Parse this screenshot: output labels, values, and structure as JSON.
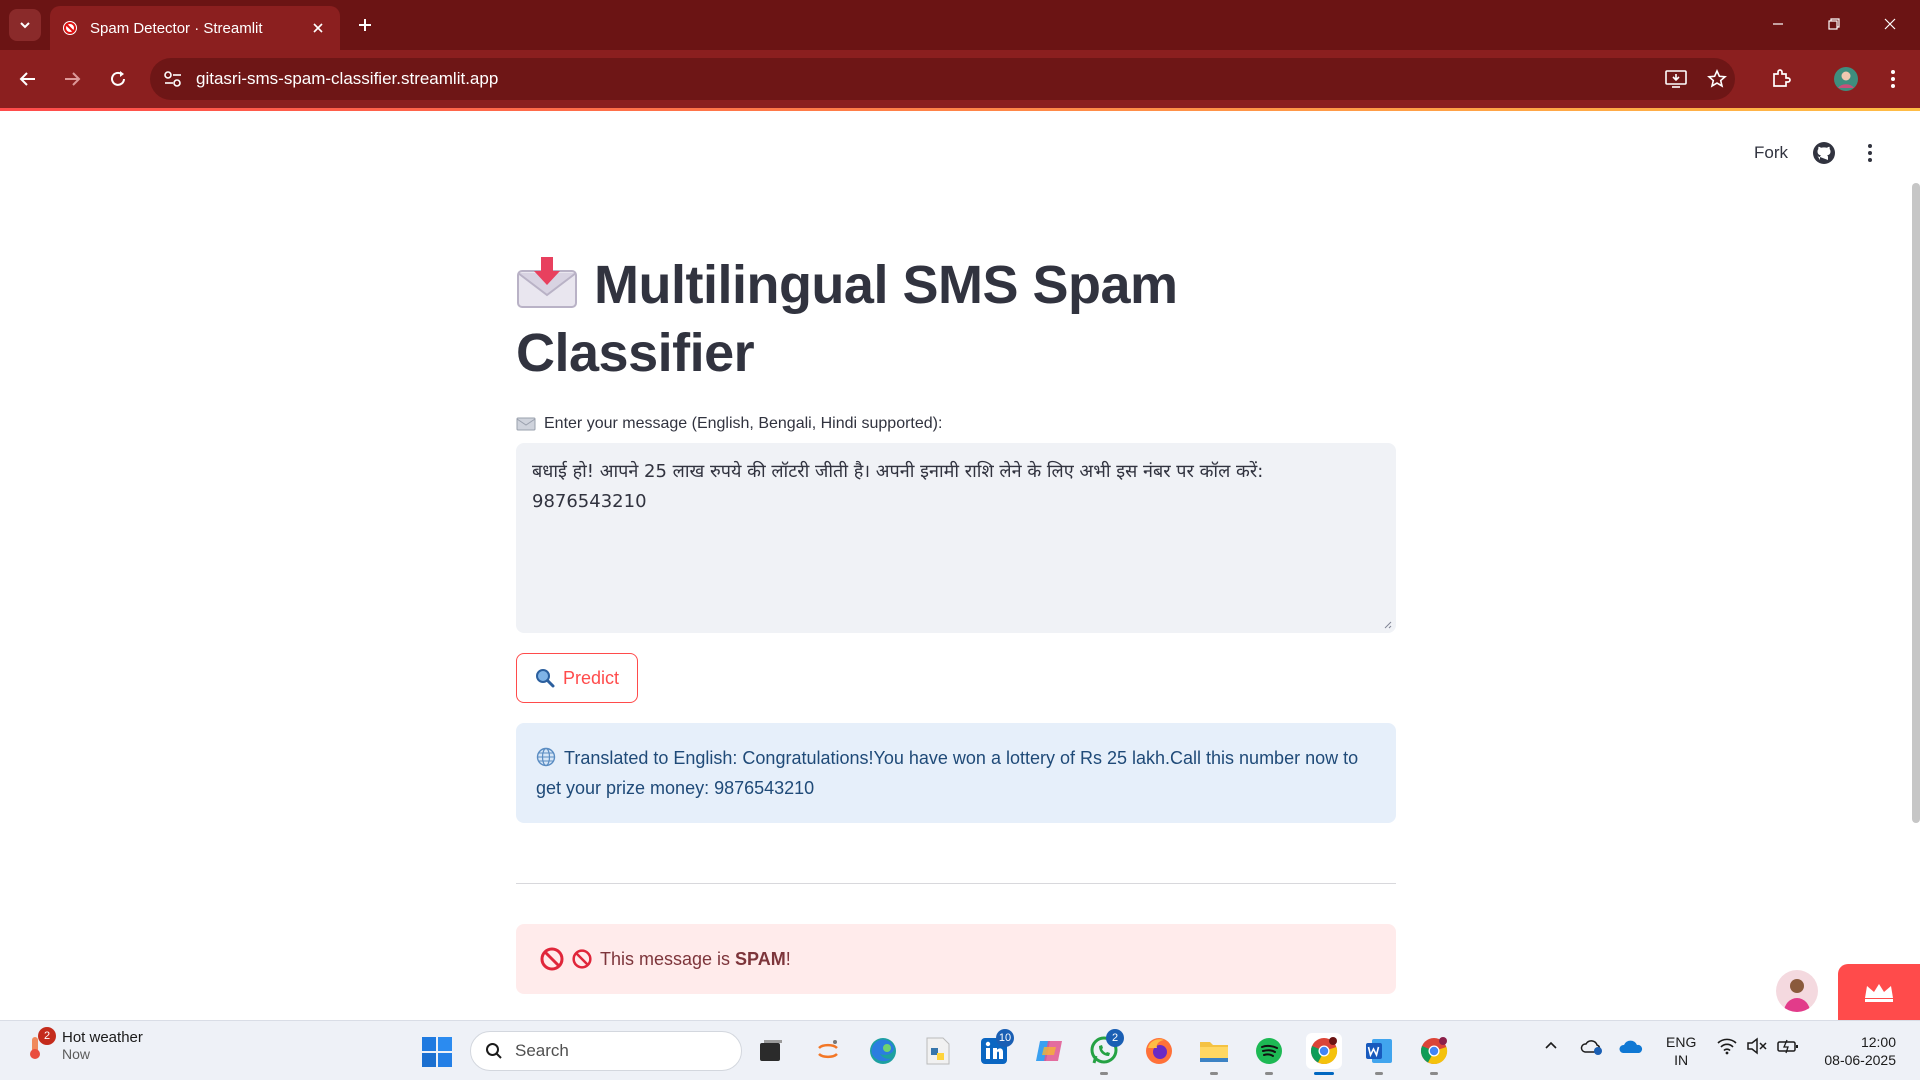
{
  "browser": {
    "tab_title": "Spam Detector · Streamlit",
    "url": "gitasri-sms-spam-classifier.streamlit.app"
  },
  "app": {
    "fork_label": "Fork",
    "title": "Multilingual SMS Spam Classifier",
    "input_label": "Enter your message (English, Bengali, Hindi supported):",
    "input_value": "बधाई हो! आपने 25 लाख रुपये की लॉटरी जीती है। अपनी इनामी राशि लेने के लिए अभी इस नंबर पर कॉल करें: 9876543210",
    "predict_label": "Predict",
    "translation": "Translated to English: Congratulations!You have won a lottery of Rs 25 lakh.Call this number now to get your prize money: 9876543210",
    "result_prefix": "This message is ",
    "result_value": "SPAM",
    "result_suffix": "!"
  },
  "taskbar": {
    "weather_title": "Hot weather",
    "weather_sub": "Now",
    "weather_badge": "2",
    "search_label": "Search",
    "linkedin_badge": "10",
    "whatsapp_badge": "2",
    "lang_line1": "ENG",
    "lang_line2": "IN",
    "time": "12:00",
    "date": "08-06-2025"
  },
  "colors": {
    "chrome": "#8b1f1f",
    "accent": "#ff4b4b",
    "info_bg": "#e6effa",
    "error_bg": "#ffebeb"
  }
}
